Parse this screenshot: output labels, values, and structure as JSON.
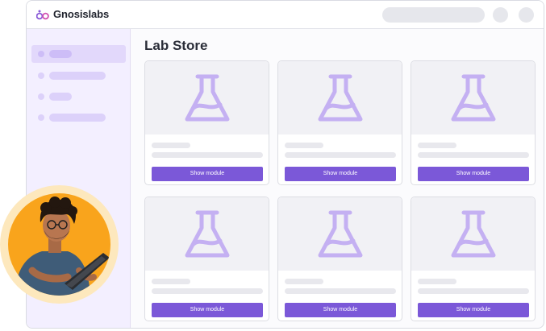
{
  "app": {
    "name": "Gnosislabs"
  },
  "page": {
    "title": "Lab Store"
  },
  "cards": [
    {
      "button_label": "Show module",
      "icon": "flask-icon"
    },
    {
      "button_label": "Show module",
      "icon": "flask-icon"
    },
    {
      "button_label": "Show module",
      "icon": "flask-icon"
    },
    {
      "button_label": "Show module",
      "icon": "flask-icon"
    },
    {
      "button_label": "Show module",
      "icon": "flask-icon"
    },
    {
      "button_label": "Show module",
      "icon": "flask-icon"
    }
  ],
  "colors": {
    "accent": "#7b58d8",
    "flask_icon": "#c4b0f2",
    "sidebar_bg": "#f3efff",
    "avatar_bg": "#f9a41c",
    "avatar_ring": "#fde8bd"
  }
}
